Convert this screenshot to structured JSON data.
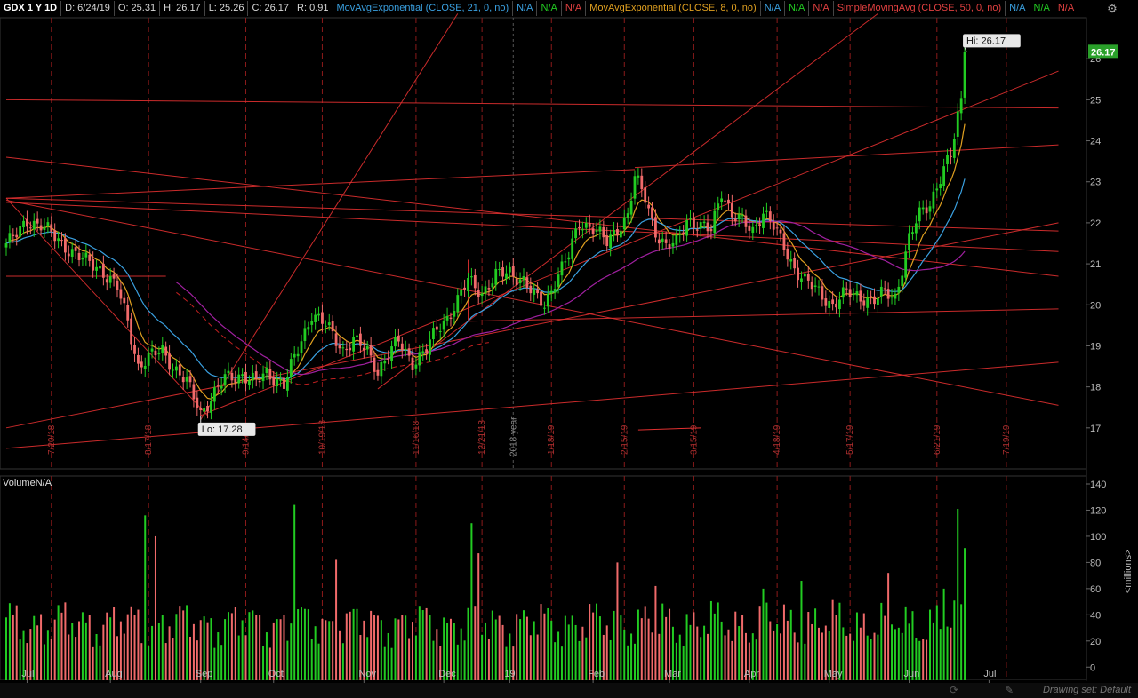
{
  "header": {
    "symbol": "GDX 1 Y 1D",
    "date": "D: 6/24/19",
    "open": "O: 25.31",
    "high": "H: 26.17",
    "low": "L: 25.26",
    "close": "C: 26.17",
    "range": "R: 0.91",
    "studies": [
      {
        "label": "MovAvgExponential (CLOSE, 21, 0, no)",
        "color": "#3aa0e0",
        "values": [
          "N/A",
          "N/A",
          "N/A"
        ]
      },
      {
        "label": "MovAvgExponential (CLOSE, 8, 0, no)",
        "color": "#e0a020",
        "values": [
          "N/A",
          "N/A",
          "N/A"
        ]
      },
      {
        "label": "SimpleMovingAvg (CLOSE, 50, 0, no)",
        "color": "#e04040",
        "values": [
          "N/A",
          "N/A",
          "N/A"
        ]
      }
    ],
    "na_colors": [
      "#3aa0e0",
      "#22cc22",
      "#e04040"
    ]
  },
  "volume_label": "VolumeN/A",
  "volume_unit": "<millions>",
  "drawing_set": "Drawing set: Default",
  "icons": {
    "corner": "settings-icon",
    "draw": "pencil-icon",
    "link": "link-icon"
  },
  "colors": {
    "up": "#22cc22",
    "down": "#f06a6a",
    "line": "#e03030",
    "ema21": "#3aa0e0",
    "ema8": "#e0a020",
    "sma50": "#a020a0",
    "last_badge": "#2aa02a"
  },
  "chart_data": [
    {
      "type": "candlestick",
      "x_axis": {
        "months": [
          "Jul",
          "Aug",
          "Sep",
          "Oct",
          "Nov",
          "Dec",
          "19",
          "Feb",
          "Mar",
          "Apr",
          "May",
          "Jun",
          "Jul"
        ],
        "event_dates": [
          "7/20/18",
          "8/17/18",
          "9/14/18",
          "10/19/18",
          "11/16/18",
          "12/21/18",
          "1/18/19",
          "2/15/19",
          "3/15/19",
          "4/18/19",
          "5/17/19",
          "6/21/19",
          "7/19/19"
        ],
        "year_marker": "2018 year"
      },
      "y_axis": {
        "ticks": [
          17,
          18,
          19,
          20,
          21,
          22,
          23,
          24,
          25,
          26
        ],
        "range": [
          16.0,
          27.0
        ]
      },
      "anchors": [
        {
          "i": 0,
          "v": 21.5
        },
        {
          "i": 3,
          "v": 21.7
        },
        {
          "i": 6,
          "v": 22.05
        },
        {
          "i": 10,
          "v": 21.95
        },
        {
          "i": 16,
          "v": 21.5
        },
        {
          "i": 22,
          "v": 21.1
        },
        {
          "i": 27,
          "v": 20.9
        },
        {
          "i": 32,
          "v": 20.4
        },
        {
          "i": 35,
          "v": 19.6
        },
        {
          "i": 38,
          "v": 18.5
        },
        {
          "i": 41,
          "v": 18.7
        },
        {
          "i": 45,
          "v": 18.9
        },
        {
          "i": 48,
          "v": 18.5
        },
        {
          "i": 52,
          "v": 18.1
        },
        {
          "i": 56,
          "v": 17.4
        },
        {
          "i": 58,
          "v": 17.6
        },
        {
          "i": 63,
          "v": 18.2
        },
        {
          "i": 68,
          "v": 18.3
        },
        {
          "i": 72,
          "v": 18.1
        },
        {
          "i": 75,
          "v": 18.35
        },
        {
          "i": 80,
          "v": 18.05
        },
        {
          "i": 84,
          "v": 18.9
        },
        {
          "i": 88,
          "v": 19.8
        },
        {
          "i": 92,
          "v": 19.5
        },
        {
          "i": 97,
          "v": 18.9
        },
        {
          "i": 100,
          "v": 19.15
        },
        {
          "i": 104,
          "v": 18.85
        },
        {
          "i": 107,
          "v": 18.4
        },
        {
          "i": 110,
          "v": 18.8
        },
        {
          "i": 113,
          "v": 19.1
        },
        {
          "i": 117,
          "v": 18.6
        },
        {
          "i": 121,
          "v": 18.9
        },
        {
          "i": 124,
          "v": 19.4
        },
        {
          "i": 127,
          "v": 19.7
        },
        {
          "i": 130,
          "v": 20.1
        },
        {
          "i": 133,
          "v": 20.6
        },
        {
          "i": 137,
          "v": 20.3
        },
        {
          "i": 141,
          "v": 20.7
        },
        {
          "i": 145,
          "v": 20.8
        },
        {
          "i": 149,
          "v": 20.6
        },
        {
          "i": 152,
          "v": 20.2
        },
        {
          "i": 155,
          "v": 20.0
        },
        {
          "i": 158,
          "v": 20.6
        },
        {
          "i": 162,
          "v": 21.2
        },
        {
          "i": 165,
          "v": 22.0
        },
        {
          "i": 169,
          "v": 21.9
        },
        {
          "i": 173,
          "v": 21.5
        },
        {
          "i": 176,
          "v": 21.85
        },
        {
          "i": 179,
          "v": 22.2
        },
        {
          "i": 181,
          "v": 23.1
        },
        {
          "i": 184,
          "v": 22.6
        },
        {
          "i": 187,
          "v": 21.8
        },
        {
          "i": 190,
          "v": 21.4
        },
        {
          "i": 193,
          "v": 21.5
        },
        {
          "i": 196,
          "v": 22.1
        },
        {
          "i": 200,
          "v": 21.9
        },
        {
          "i": 203,
          "v": 21.8
        },
        {
          "i": 206,
          "v": 22.8
        },
        {
          "i": 209,
          "v": 22.2
        },
        {
          "i": 212,
          "v": 22.0
        },
        {
          "i": 215,
          "v": 21.8
        },
        {
          "i": 218,
          "v": 22.3
        },
        {
          "i": 221,
          "v": 21.9
        },
        {
          "i": 224,
          "v": 21.4
        },
        {
          "i": 227,
          "v": 20.9
        },
        {
          "i": 230,
          "v": 20.6
        },
        {
          "i": 234,
          "v": 20.3
        },
        {
          "i": 238,
          "v": 20.0
        },
        {
          "i": 242,
          "v": 20.3
        },
        {
          "i": 246,
          "v": 20.2
        },
        {
          "i": 250,
          "v": 20.1
        },
        {
          "i": 253,
          "v": 20.3
        },
        {
          "i": 256,
          "v": 20.2
        },
        {
          "i": 258,
          "v": 20.9
        },
        {
          "i": 260,
          "v": 21.6
        },
        {
          "i": 263,
          "v": 22.2
        },
        {
          "i": 266,
          "v": 22.5
        },
        {
          "i": 268,
          "v": 22.9
        },
        {
          "i": 270,
          "v": 23.3
        },
        {
          "i": 272,
          "v": 23.6
        },
        {
          "i": 274,
          "v": 24.6
        },
        {
          "i": 275,
          "v": 25.0
        },
        {
          "i": 276,
          "v": 26.0
        }
      ],
      "n_bars": 277,
      "last_close": 26.17,
      "last_label": "26.17",
      "hi_label": "Hi: 26.17",
      "lo_label": "Lo: 17.28",
      "hi": {
        "i": 276,
        "v": 26.17
      },
      "lo": {
        "i": 56,
        "v": 17.28
      },
      "studies": [
        {
          "name": "MovAvgExponential (CLOSE, 8, 0, no)",
          "period": 8,
          "kind": "ema"
        },
        {
          "name": "MovAvgExponential (CLOSE, 21, 0, no)",
          "period": 21,
          "kind": "ema"
        },
        {
          "name": "SimpleMovingAvg (CLOSE, 50, 0, no)",
          "period": 50,
          "kind": "sma"
        }
      ],
      "trendlines": [
        {
          "from": [
            0,
            25.0
          ],
          "to": [
            303,
            24.8
          ]
        },
        {
          "from": [
            0,
            22.6
          ],
          "to": [
            303,
            21.8
          ]
        },
        {
          "from": [
            0,
            22.5
          ],
          "to": [
            303,
            21.3
          ]
        },
        {
          "from": [
            0,
            22.55
          ],
          "to": [
            303,
            17.55
          ]
        },
        {
          "from": [
            0,
            23.6
          ],
          "to": [
            303,
            20.7
          ]
        },
        {
          "from": [
            0,
            22.6
          ],
          "to": [
            58,
            17.3
          ]
        },
        {
          "from": [
            0,
            22.6
          ],
          "to": [
            181,
            23.3
          ]
        },
        {
          "from": [
            0,
            17.0
          ],
          "to": [
            303,
            22.0
          ]
        },
        {
          "from": [
            0,
            16.5
          ],
          "to": [
            303,
            18.6
          ]
        },
        {
          "from": [
            56,
            17.3
          ],
          "to": [
            303,
            25.7
          ]
        },
        {
          "from": [
            107,
            17.95
          ],
          "to": [
            251,
            27.1
          ]
        },
        {
          "from": [
            133,
            19.6
          ],
          "to": [
            303,
            19.9
          ]
        },
        {
          "from": [
            133,
            19.6
          ],
          "to": [
            133,
            21.1
          ]
        },
        {
          "from": [
            181,
            23.35
          ],
          "to": [
            303,
            23.9
          ]
        },
        {
          "from": [
            56,
            17.2
          ],
          "to": [
            130,
            27.1
          ]
        },
        {
          "from": [
            0,
            20.7
          ],
          "to": [
            46,
            20.7
          ]
        }
      ]
    },
    {
      "type": "bar",
      "title": "VolumeN/A",
      "ylabel": "<millions>",
      "y_axis": {
        "ticks": [
          0,
          20,
          40,
          60,
          80,
          100,
          120,
          140
        ],
        "range": [
          -10,
          140
        ]
      },
      "spikes": [
        {
          "i": 40,
          "v": 116
        },
        {
          "i": 43,
          "v": 100
        },
        {
          "i": 83,
          "v": 124
        },
        {
          "i": 95,
          "v": 82
        },
        {
          "i": 134,
          "v": 110
        },
        {
          "i": 136,
          "v": 87
        },
        {
          "i": 176,
          "v": 80
        },
        {
          "i": 187,
          "v": 62
        },
        {
          "i": 218,
          "v": 60
        },
        {
          "i": 229,
          "v": 66
        },
        {
          "i": 254,
          "v": 72
        },
        {
          "i": 270,
          "v": 60
        },
        {
          "i": 274,
          "v": 121
        },
        {
          "i": 276,
          "v": 91
        }
      ],
      "base_volume": 33
    }
  ]
}
